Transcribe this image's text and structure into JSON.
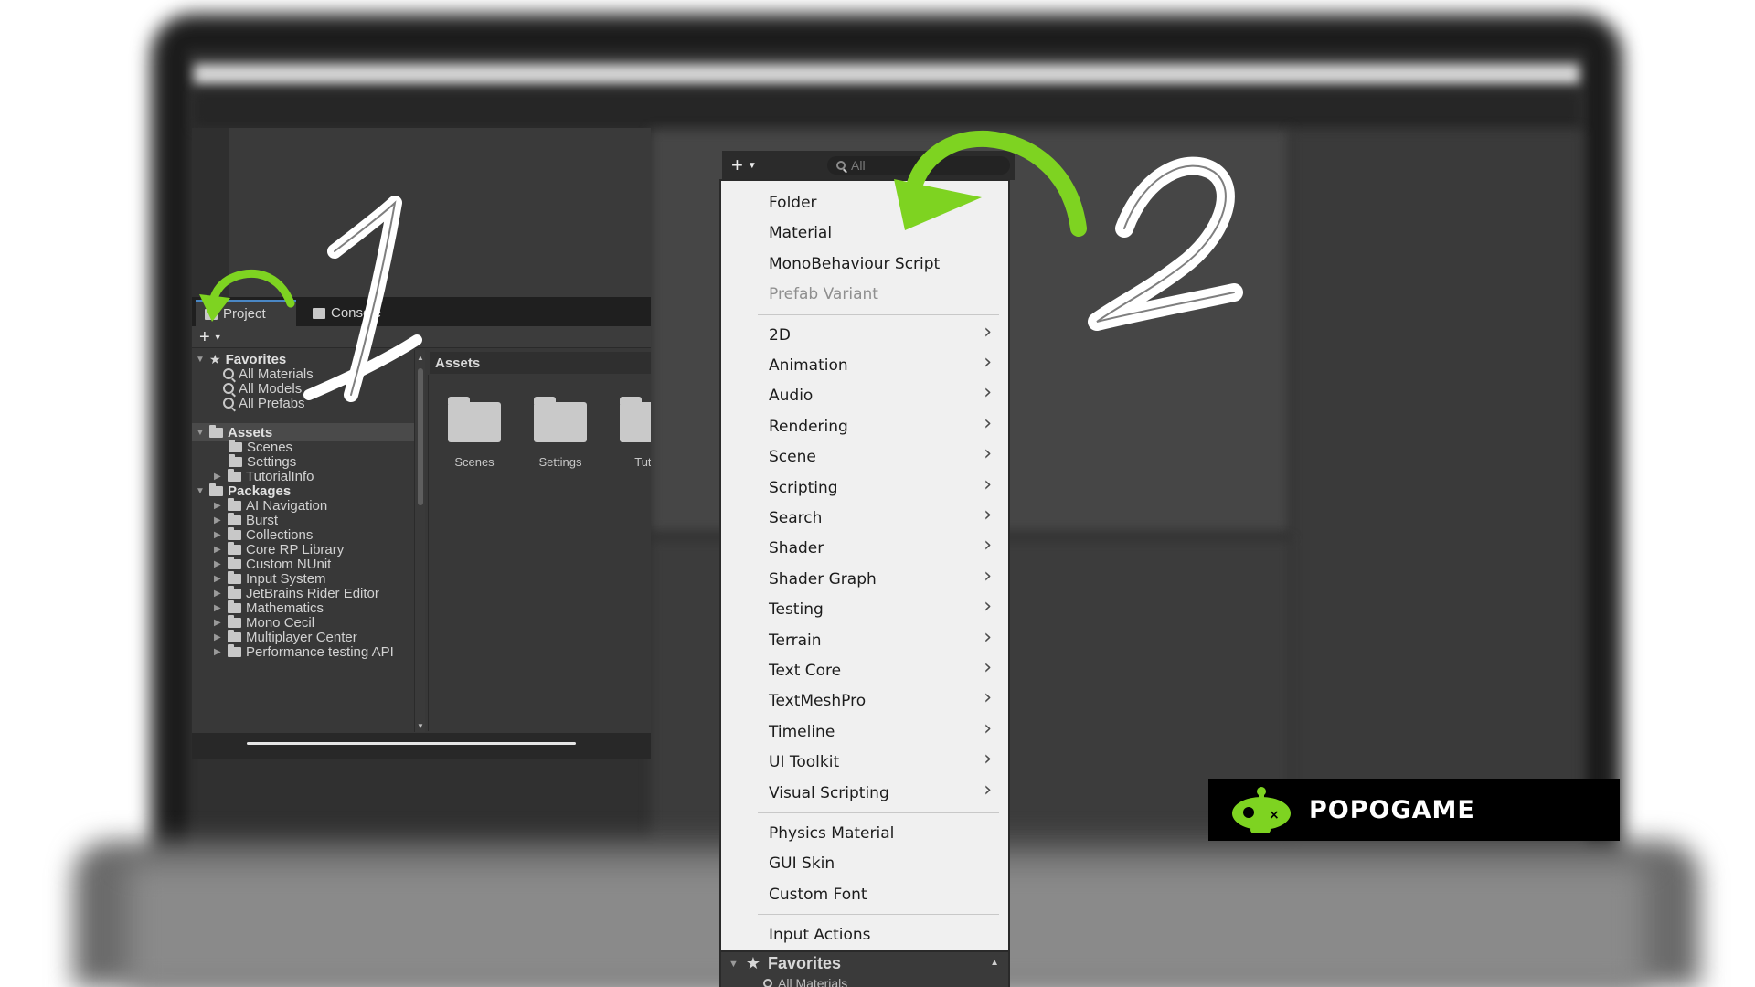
{
  "panel1": {
    "tabs": [
      "Project",
      "Console"
    ],
    "favorites_label": "Favorites",
    "favorites": [
      "All Materials",
      "All Models",
      "All Prefabs"
    ],
    "assets_label": "Assets",
    "asset_folders": [
      "Scenes",
      "Settings",
      "TutorialInfo"
    ],
    "packages_label": "Packages",
    "packages": [
      "AI Navigation",
      "Burst",
      "Collections",
      "Core RP Library",
      "Custom NUnit",
      "Input System",
      "JetBrains Rider Editor",
      "Mathematics",
      "Mono Cecil",
      "Multiplayer Center",
      "Performance testing API"
    ],
    "assets_header": "Assets",
    "grid_items": [
      "Scenes",
      "Settings",
      "Tuto"
    ]
  },
  "panel2": {
    "search_placeholder": "All",
    "menu_groups": [
      [
        {
          "label": "Folder"
        },
        {
          "label": "Material"
        },
        {
          "label": "MonoBehaviour Script"
        },
        {
          "label": "Prefab Variant",
          "disabled": true
        }
      ],
      [
        {
          "label": "2D",
          "submenu": true
        },
        {
          "label": "Animation",
          "submenu": true
        },
        {
          "label": "Audio",
          "submenu": true
        },
        {
          "label": "Rendering",
          "submenu": true
        },
        {
          "label": "Scene",
          "submenu": true
        },
        {
          "label": "Scripting",
          "submenu": true
        },
        {
          "label": "Search",
          "submenu": true
        },
        {
          "label": "Shader",
          "submenu": true
        },
        {
          "label": "Shader Graph",
          "submenu": true
        },
        {
          "label": "Testing",
          "submenu": true
        },
        {
          "label": "Terrain",
          "submenu": true
        },
        {
          "label": "Text Core",
          "submenu": true
        },
        {
          "label": "TextMeshPro",
          "submenu": true
        },
        {
          "label": "Timeline",
          "submenu": true
        },
        {
          "label": "UI Toolkit",
          "submenu": true
        },
        {
          "label": "Visual Scripting",
          "submenu": true
        }
      ],
      [
        {
          "label": "Physics Material"
        },
        {
          "label": "GUI Skin"
        },
        {
          "label": "Custom Font"
        }
      ],
      [
        {
          "label": "Input Actions"
        }
      ]
    ],
    "bottom_favorites": "Favorites",
    "bottom_sub": "All Materials"
  },
  "annotations": {
    "step1": "1",
    "step2": "2",
    "arrow_color": "#7ed321"
  },
  "logo": {
    "text": "POPOGAME",
    "accent": "#7ed321"
  }
}
